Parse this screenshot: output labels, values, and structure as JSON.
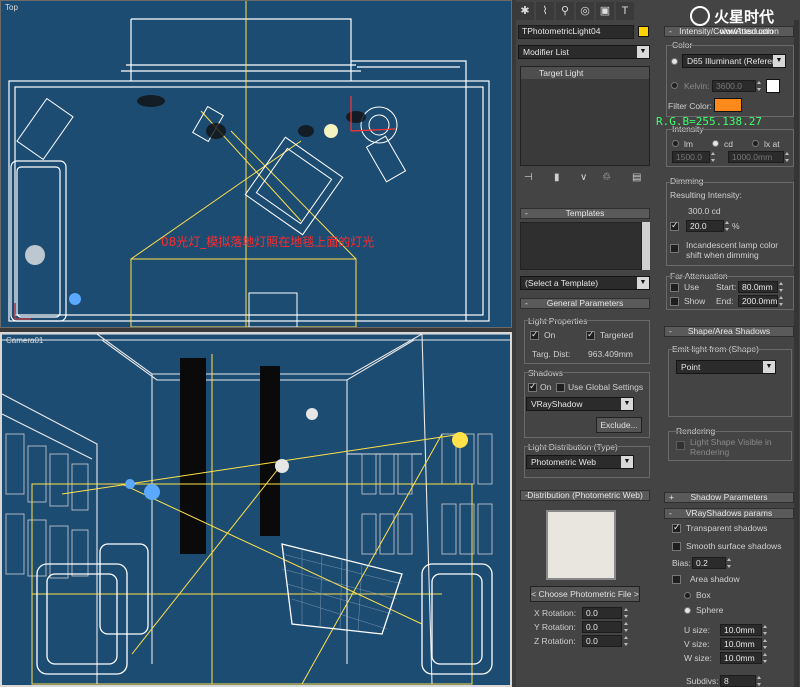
{
  "viewports": {
    "top_label": "Top",
    "camera_label": "Camera01",
    "annotation": "08光灯_模拟落地灯照在地毯上面的灯光"
  },
  "watermark": {
    "text": "火星时代",
    "url": "www.hxsd.com",
    "rgb_note": "R.G.B=255.138.27"
  },
  "command_panel": {
    "tabs": [
      "create-icon",
      "modify-icon",
      "hierarchy-icon",
      "motion-icon",
      "display-icon",
      "utilities-icon"
    ],
    "object_name": "TPhotometricLight04",
    "object_color": "#ffd400",
    "modifier_list": "Modifier List",
    "stack_item": "Target Light",
    "stack_tools": [
      "pin-stack-icon",
      "show-end-result-icon",
      "make-unique-icon",
      "remove-modifier-icon",
      "configure-sets-icon"
    ],
    "templates": {
      "title": "Templates",
      "select": "(Select a Template)"
    },
    "general": {
      "title": "General Parameters",
      "light_props": "Light Properties",
      "on": "On",
      "targeted": "Targeted",
      "targ_dist_label": "Targ. Dist:",
      "targ_dist_value": "963.409mm",
      "shadows": "Shadows",
      "shadows_on": "On",
      "use_global": "Use Global Settings",
      "shadow_type": "VRayShadow",
      "exclude": "Exclude...",
      "distribution_label": "Light Distribution (Type)",
      "distribution": "Photometric Web"
    },
    "distribution_web": {
      "title": "Distribution (Photometric Web)",
      "choose": "< Choose Photometric File >",
      "x_label": "X Rotation:",
      "x_value": "0.0",
      "y_label": "Y Rotation:",
      "y_value": "0.0",
      "z_label": "Z Rotation:",
      "z_value": "0.0"
    },
    "intensity_color": {
      "title": "Intensity/Color/Attenuation",
      "color_label": "Color",
      "preset": "D65 Illuminant (Reference White)",
      "kelvin_label": "Kelvin:",
      "kelvin_value": "3600.0",
      "kelvin_swatch": "#ffffff",
      "filter_label": "Filter Color:",
      "filter_color": "#ff8a1b",
      "intensity_label": "Intensity",
      "unit_lm": "lm",
      "unit_cd": "cd",
      "unit_lx": "lx at",
      "lm_value": "1500.0",
      "lx_value": "1000.0mm",
      "dimming_label": "Dimming",
      "resulting_label": "Resulting Intensity:",
      "resulting_value": "300.0 cd",
      "dim_value": "20.0",
      "percent": "%",
      "incandescent": "Incandescent lamp color shift when dimming",
      "far_label": "Far Attenuation",
      "use": "Use",
      "show": "Show",
      "start_label": "Start:",
      "start_value": "80.0mm",
      "end_label": "End:",
      "end_value": "200.0mm"
    },
    "shape_area": {
      "title": "Shape/Area Shadows",
      "emit_label": "Emit light from (Shape)",
      "shape": "Point",
      "rendering_label": "Rendering",
      "light_shape_visible": "Light Shape Visible in Rendering"
    },
    "shadow_params": {
      "title": "Shadow Parameters"
    },
    "vray_shadows": {
      "title": "VRayShadows params",
      "transparent": "Transparent shadows",
      "smooth": "Smooth surface shadows",
      "bias_label": "Bias:",
      "bias_value": "0.2",
      "area_shadow": "Area shadow",
      "box": "Box",
      "sphere": "Sphere",
      "u_label": "U size:",
      "u_value": "10.0mm",
      "v_label": "V size:",
      "v_value": "10.0mm",
      "w_label": "W size:",
      "w_value": "10.0mm",
      "subdivs_label": "Subdivs:",
      "subdivs_value": "8"
    }
  }
}
